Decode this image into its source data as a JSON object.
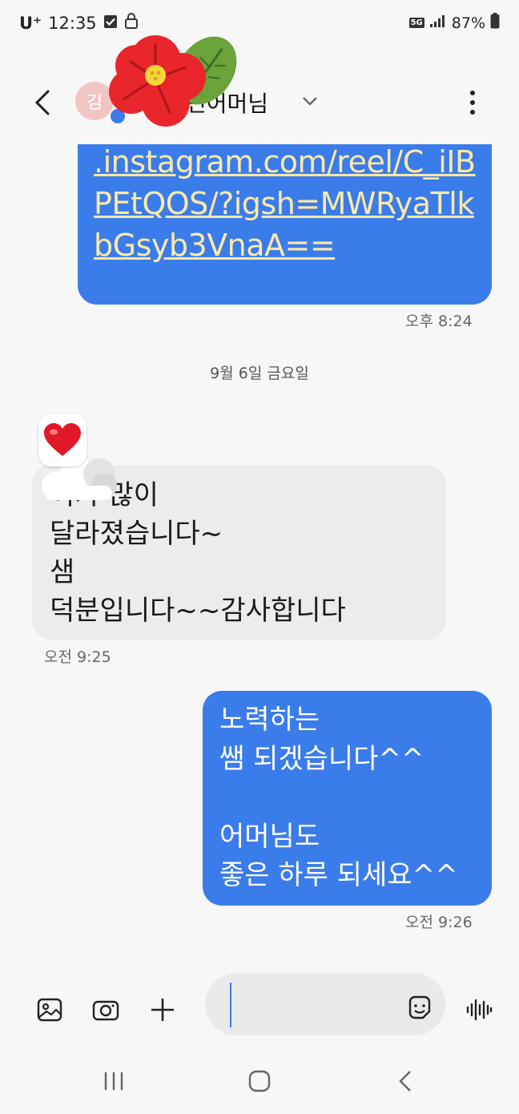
{
  "status_bar": {
    "carrier": "U⁺",
    "time": "12:35",
    "network": "5G",
    "battery": "87%"
  },
  "header": {
    "avatar_initial": "김",
    "contact_name": "민어머님"
  },
  "messages": {
    "link_text": ".instagram.com/reel/C_iIBPEtQOS/?igsh=MWRyaTlkbGsyb3VnaA==",
    "link_time": "오후 8:24",
    "date_separator": "9월 6일 금요일",
    "received_text": "   이가 많이\n달라졌습니다~\n샘\n덕분입니다~~감사합니다",
    "received_time": "오전 9:25",
    "sent_text": "노력하는\n쌤 되겠습니다^^\n\n어머님도\n좋은 하루 되세요^^",
    "sent_time": "오전 9:26"
  },
  "composer": {
    "input_value": ""
  },
  "colors": {
    "sent_bubble": "#3b7ceb",
    "received_bubble": "#ececec",
    "link": "#ffe9a5",
    "background": "#f7f7f7"
  }
}
